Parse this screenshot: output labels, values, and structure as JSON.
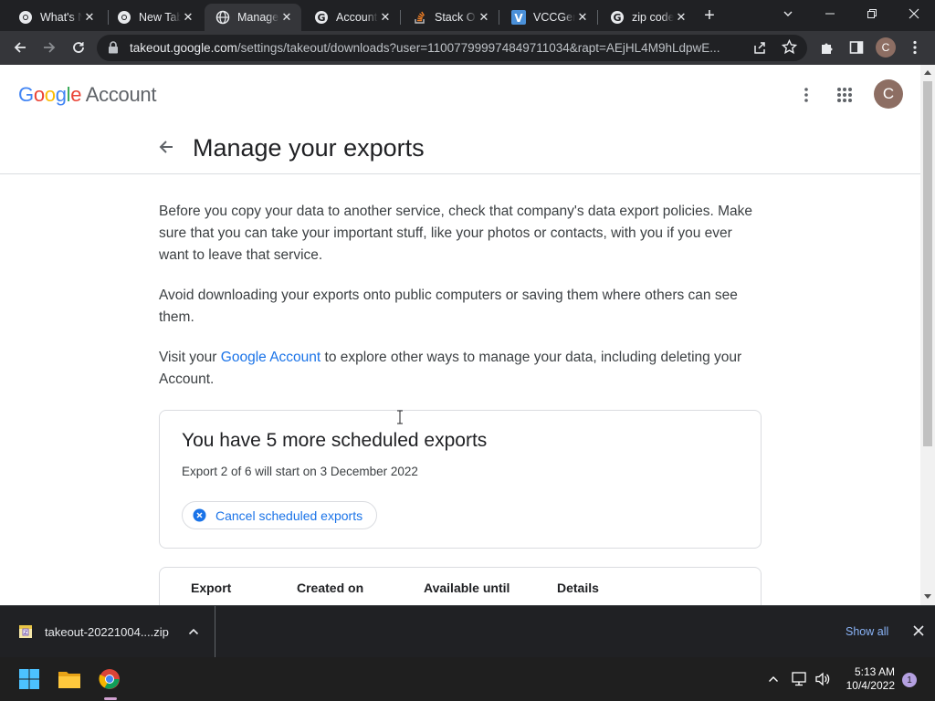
{
  "browser": {
    "tabs": [
      {
        "title": "What's N",
        "favicon": "chrome-icon"
      },
      {
        "title": "New Tab",
        "favicon": "chrome-icon"
      },
      {
        "title": "Manage",
        "favicon": "globe-icon"
      },
      {
        "title": "Account",
        "favicon": "google-icon"
      },
      {
        "title": "Stack O",
        "favicon": "stackoverflow-icon"
      },
      {
        "title": "VCCGen",
        "favicon": "v-icon"
      },
      {
        "title": "zip code",
        "favicon": "google-icon"
      }
    ],
    "url_host": "takeout.google.com",
    "url_path": "/settings/takeout/downloads?user=110077999974849711034&rapt=AEjHL4M9hLdpwE...",
    "profile_initial": "C"
  },
  "header": {
    "logo_google": "Google",
    "logo_account": "Account",
    "avatar_initial": "C"
  },
  "page": {
    "title": "Manage your exports",
    "para1": "Before you copy your data to another service, check that company's data export policies. Make sure that you can take your important stuff, like your photos or contacts, with you if you ever want to leave that service.",
    "para2": "Avoid downloading your exports onto public computers or saving them where others can see them.",
    "para3_before": "Visit your ",
    "para3_link": "Google Account",
    "para3_after": " to explore other ways to manage your data, including deleting your Account."
  },
  "scheduled": {
    "title": "You have 5 more scheduled exports",
    "subtitle": "Export 2 of 6 will start on 3 December 2022",
    "cancel_label": "Cancel scheduled exports"
  },
  "table": {
    "headers": [
      "Export",
      "Created on",
      "Available until",
      "Details"
    ]
  },
  "downloads": {
    "file_name": "takeout-20221004....zip",
    "show_all": "Show all"
  },
  "taskbar": {
    "time": "5:13 AM",
    "date": "10/4/2022",
    "notifications": "1"
  },
  "colors": {
    "link": "#1a73e8",
    "google_blue": "#4285f4",
    "google_red": "#ea4335",
    "google_yellow": "#fbbc05",
    "google_green": "#34a853",
    "avatar": "#8d6e63"
  }
}
